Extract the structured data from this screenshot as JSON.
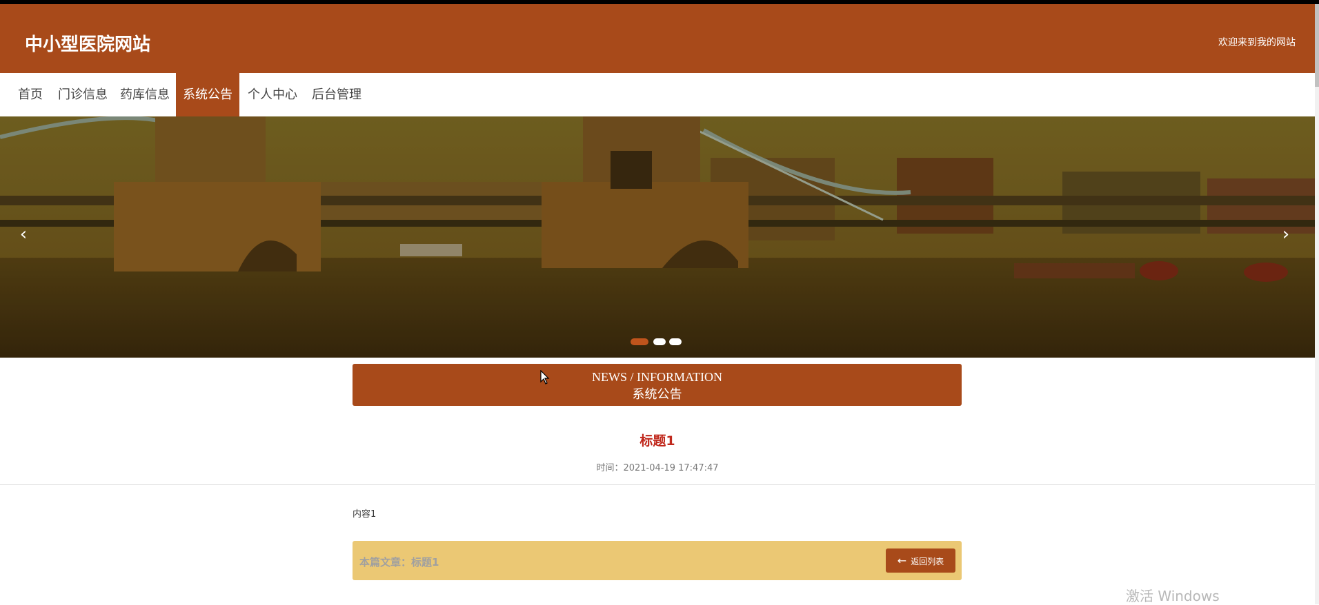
{
  "header": {
    "site_title": "中小型医院网站",
    "welcome": "欢迎来到我的网站",
    "bg_color": "#a84a1a"
  },
  "nav": {
    "items": [
      {
        "label": "首页"
      },
      {
        "label": "门诊信息"
      },
      {
        "label": "药库信息"
      },
      {
        "label": "系统公告",
        "active": true
      },
      {
        "label": "个人中心"
      },
      {
        "label": "后台管理"
      }
    ]
  },
  "banner": {
    "prev_icon": "chevron-left-icon",
    "next_icon": "chevron-right-icon",
    "prev_glyph": "‹",
    "next_glyph": "›",
    "active_slide": 1,
    "slide_count": 3
  },
  "news": {
    "title_en": "NEWS / INFORMATION",
    "title_cn": "系统公告"
  },
  "article": {
    "title": "标题1",
    "time": "时间：2021-04-19 17:47:47",
    "content": "内容1"
  },
  "footer": {
    "current_label": "本篇文章：标题1",
    "back_label": "返回列表",
    "back_icon": "arrow-left-icon",
    "back_glyph": "←"
  },
  "watermark": "激活 Windows",
  "colors": {
    "accent": "#a84a1a",
    "title_red": "#c0281c",
    "footer_yellow": "#ebc874"
  }
}
